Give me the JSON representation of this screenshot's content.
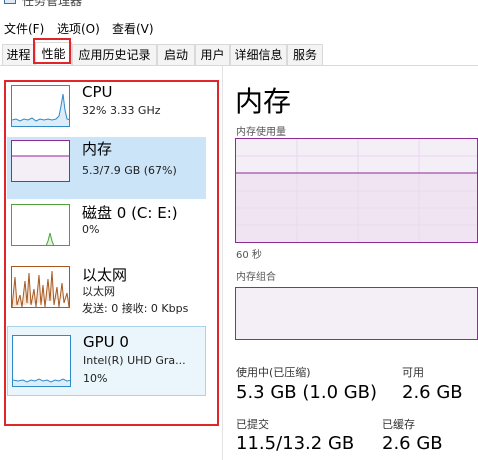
{
  "window": {
    "title": "任务管理器"
  },
  "menu": [
    {
      "label": "文件(F)"
    },
    {
      "label": "选项(O)"
    },
    {
      "label": "查看(V)"
    }
  ],
  "tabs": [
    {
      "label": "进程"
    },
    {
      "label": "性能",
      "active": true
    },
    {
      "label": "应用历史记录"
    },
    {
      "label": "启动"
    },
    {
      "label": "用户"
    },
    {
      "label": "详细信息"
    },
    {
      "label": "服务"
    }
  ],
  "sidebar": {
    "items": [
      {
        "name": "CPU",
        "detail1": "32%  3.33 GHz",
        "color": "#2f8bc8",
        "icon": "cpu-graph"
      },
      {
        "name": "内存",
        "detail1": "5.3/7.9 GB (67%)",
        "color": "#8b2b95",
        "icon": "memory-graph",
        "selected": true
      },
      {
        "name": "磁盘 0 (C: E:)",
        "detail1": "0%",
        "color": "#4ca13a",
        "icon": "disk-graph"
      },
      {
        "name": "以太网",
        "detail1": "以太网",
        "detail2": "发送: 0 接收: 0 Kbps",
        "color": "#a7581f",
        "icon": "ethernet-graph"
      },
      {
        "name": "GPU 0",
        "detail1": "Intel(R) UHD Gra...",
        "detail2": "10%",
        "color": "#2f8bc8",
        "icon": "gpu-graph"
      }
    ]
  },
  "main": {
    "title": "内存",
    "usage_label": "内存使用量",
    "time_label": "60 秒",
    "composition_label": "内存组合",
    "accent_color": "#8b2b95",
    "stats": {
      "in_use_label": "使用中(已压缩)",
      "in_use_value": "5.3 GB (1.0 GB)",
      "available_label": "可用",
      "available_value": "2.6 GB",
      "committed_label": "已提交",
      "committed_value": "11.5/13.2 GB",
      "cached_label": "已缓存",
      "cached_value": "2.6 GB"
    }
  }
}
